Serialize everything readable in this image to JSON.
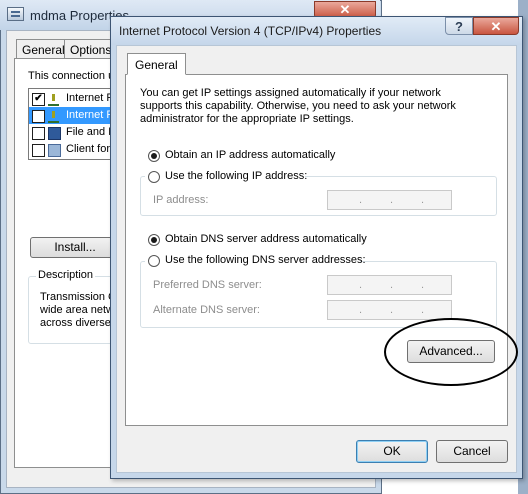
{
  "back_window": {
    "title": "mdma Properties",
    "close_glyph": "✕",
    "tabs": [
      {
        "label": "General"
      },
      {
        "label": "Options"
      }
    ],
    "connection_label": "This connection u",
    "items": [
      {
        "label": "Internet P",
        "checked": true,
        "icon": "protocol-icon"
      },
      {
        "label": "Internet P",
        "checked": true,
        "selected": true,
        "icon": "protocol-icon"
      },
      {
        "label": "File and P",
        "checked": false,
        "icon": "share-icon"
      },
      {
        "label": "Client for",
        "checked": false,
        "icon": "client-icon"
      }
    ],
    "check_glyph": "✔",
    "install_label": "Install...",
    "description_legend": "Description",
    "description_text": "Transmission C\nwide area netw\nacross diverse"
  },
  "dialog": {
    "title": "Internet Protocol Version 4 (TCP/IPv4) Properties",
    "help_glyph": "?",
    "close_glyph": "✕",
    "tab_label": "General",
    "intro": "You can get IP settings assigned automatically if your network\nsupports this capability. Otherwise, you need to ask your network\nadministrator for the appropriate IP settings.",
    "ip_auto_label": "Obtain an IP address automatically",
    "ip_manual_label": "Use the following IP address:",
    "ip_address_label": "IP address:",
    "dns_auto_label": "Obtain DNS server address automatically",
    "dns_manual_label": "Use the following DNS server addresses:",
    "preferred_dns_label": "Preferred DNS server:",
    "alternate_dns_label": "Alternate DNS server:",
    "ip_dot": ".",
    "advanced_label": "Advanced...",
    "ok_label": "OK",
    "cancel_label": "Cancel",
    "selected_ip_option": "Obtain an IP address automatically",
    "selected_dns_option": "Obtain DNS server address automatically"
  }
}
